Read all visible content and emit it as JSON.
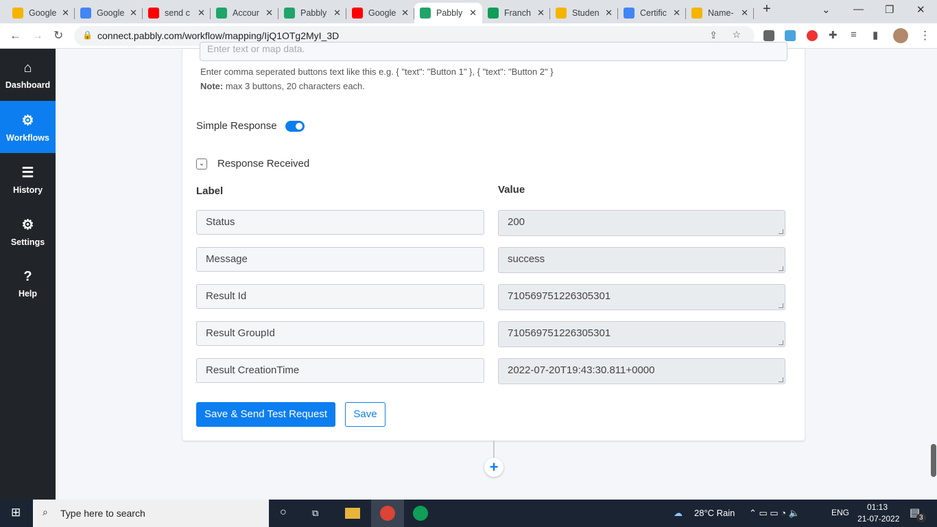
{
  "browser": {
    "tabs": [
      {
        "title": "Google",
        "color": "#f4b400"
      },
      {
        "title": "Google",
        "color": "#4285f4"
      },
      {
        "title": "send c",
        "color": "#ff0000"
      },
      {
        "title": "Accour",
        "color": "#20a46a"
      },
      {
        "title": "Pabbly",
        "color": "#20a46a"
      },
      {
        "title": "Google",
        "color": "#ff0000"
      },
      {
        "title": "Pabbly",
        "color": "#20a46a",
        "active": true
      },
      {
        "title": "Franch",
        "color": "#0f9d58"
      },
      {
        "title": "Studen",
        "color": "#f4b400"
      },
      {
        "title": "Certific",
        "color": "#4285f4"
      },
      {
        "title": "Name-",
        "color": "#f4b400"
      }
    ],
    "url": "connect.pabbly.com/workflow/mapping/IjQ1OTg2MyI_3D"
  },
  "sidebar": [
    {
      "label": "Dashboard",
      "icon": "⌂"
    },
    {
      "label": "Workflows",
      "icon": "⚙",
      "active": true
    },
    {
      "label": "History",
      "icon": "☰"
    },
    {
      "label": "Settings",
      "icon": "⚙"
    },
    {
      "label": "Help",
      "icon": "?"
    }
  ],
  "form": {
    "buttons_placeholder": "Enter text or map data.",
    "help_text": "Enter comma seperated buttons text like this e.g. { \"text\": \"Button 1\" }, { \"text\": \"Button 2\" }",
    "note_label": "Note:",
    "note_text": " max 3 buttons, 20 characters each.",
    "simple_response": "Simple Response",
    "simple_response_on": true,
    "response_received": "Response Received",
    "label_header": "Label",
    "value_header": "Value",
    "rows": [
      {
        "label": "Status",
        "value": "200"
      },
      {
        "label": "Message",
        "value": "success"
      },
      {
        "label": "Result Id",
        "value": "710569751226305301"
      },
      {
        "label": "Result GroupId",
        "value": "710569751226305301"
      },
      {
        "label": "Result CreationTime",
        "value": "2022-07-20T19:43:30.811+0000"
      }
    ],
    "save_send": "Save & Send Test Request",
    "save": "Save"
  },
  "taskbar": {
    "search": "Type here to search",
    "weather": "28°C  Rain",
    "lang": "ENG",
    "time": "01:13",
    "date": "21-07-2022",
    "notifications": "3"
  }
}
